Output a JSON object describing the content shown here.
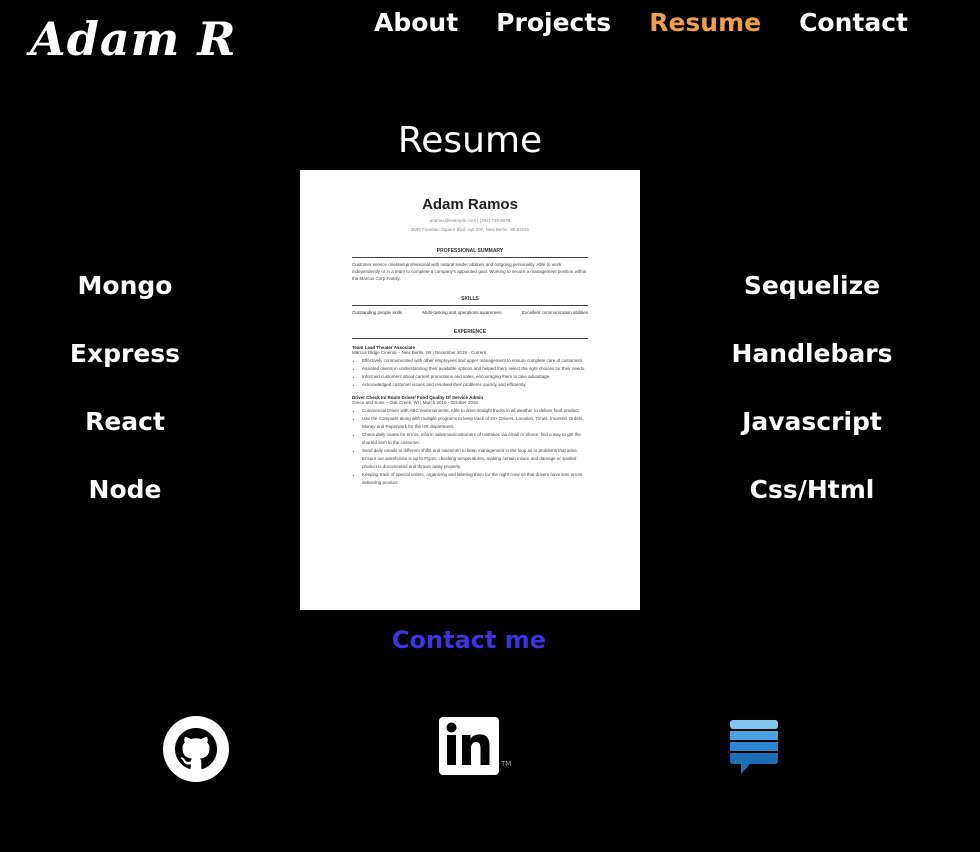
{
  "logo": "Adam R",
  "nav": [
    "About",
    "Projects",
    "Resume",
    "Contact"
  ],
  "page_title": "Resume",
  "skills_left": [
    "Mongo",
    "Express",
    "React",
    "Node"
  ],
  "skills_right": [
    "Sequelize",
    "Handlebars",
    "Javascript",
    "Css/Html"
  ],
  "resume": {
    "name": "Adam Ramos",
    "email_phone": "aramos@example.com | (262) 719-5078",
    "address": "3665 Fountain Square Blvd, Apt 207, New Berlin, WI 53151",
    "summary_title": "PROFESSIONAL SUMMARY",
    "summary": "Customer service oriented professional with natural leader abilities and outgoing personality. Able to work independently or in a team to complete a company's appointed goal. Working to secure a management position within the Marcus Corp Family.",
    "skills_title": "SKILLS",
    "skills": [
      "Outstanding people skills",
      "Multi-tasking and operations awareness",
      "Excellent communication abilities"
    ],
    "experience_title": "EXPERIENCE",
    "job1_title": "Team Lead Theater Associate",
    "job1_sub": "Marcus Ridge Cinema – New Berlin, WI | December 2019 - Current",
    "job1_items": [
      "Effectively communicated with other employees and upper management to ensure complete care of customers.",
      "Assisted clients in understanding their available options and helped them select the right choices for their needs.",
      "Informed customers about current promotions and sales, encouraging them to take advantage.",
      "Acknowledged customer issues and resolved their problems quickly and efficiently."
    ],
    "job2_title": "Driver Check In/ Route Driver/ Food Quality Of Service Admin",
    "job2_sub": "Greco and Sons – Oak Creek, WI | March 2016 - October 2018",
    "job2_items": [
      "Commercial Driver with ABC endorsements. Able to drive straight trucks in all weather to deliver food product.",
      "Use the Computer along with multiple programs to keep track of 20+ Drivers, Location, Times, Incorrect Orders, Money and Paperwork for the HR department.",
      "Check daily routes for errors, inform salesman/customers of mistakes via email or phone, find a way to get the shorted item to the customer.",
      "Send daily emails to different shifts and salesmen to keep management in the loop as to problems that arise. Ensure our warehouse is up to FQoS, checking temperatures, making certain insure and damage or spoiled product is documented and thrown away properly.",
      "Keeping track of special orders, organizing and labeling them for the night crew so that drivers have less errors delivering product."
    ]
  },
  "contact_link": "Contact me",
  "socials": [
    "github-icon",
    "linkedin-icon",
    "stackoverflow-icon"
  ],
  "linkedin_text": "in",
  "tm": "TM",
  "colors": {
    "active_nav": "#f0a04b",
    "contact": "#3b34e0",
    "background": "#000000"
  }
}
